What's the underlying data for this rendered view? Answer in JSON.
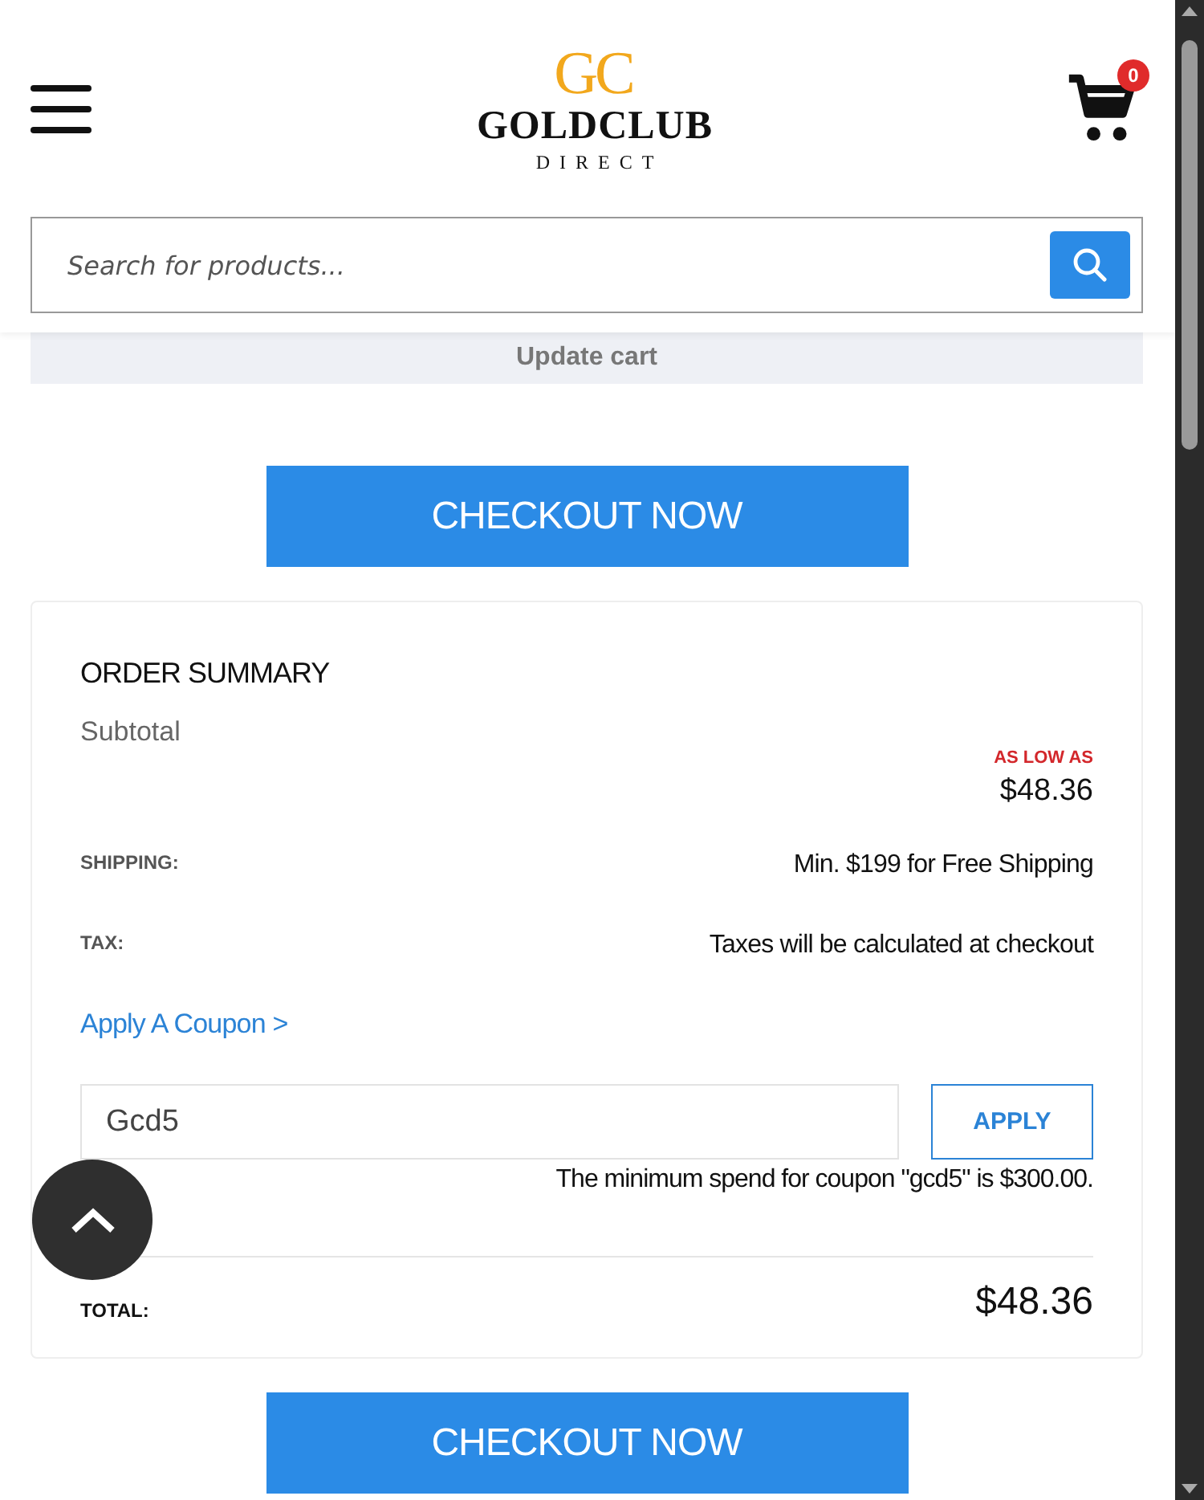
{
  "header": {
    "logo_mark": "GC",
    "logo_name": "GOLDCLUB",
    "logo_sub": "DIRECT",
    "cart_count": "0"
  },
  "search": {
    "placeholder": "Search for products..."
  },
  "update_cart": "Update cart",
  "checkout_top": "CHECKOUT NOW",
  "summary": {
    "title": "ORDER SUMMARY",
    "subtotal_label": "Subtotal",
    "price_note": "AS LOW AS",
    "subtotal": "$48.36",
    "rows": [
      {
        "label": "SHIPPING:",
        "value": "Min. $199 for Free Shipping"
      },
      {
        "label": "TAX:",
        "value": "Taxes will be calculated at checkout"
      }
    ],
    "coupon_link": "Apply A Coupon >",
    "coupon_value": "Gcd5",
    "apply": "APPLY",
    "coupon_error": "The minimum spend for coupon \"gcd5\" is $300.00.",
    "total_label": "TOTAL:",
    "total": "$48.36"
  },
  "checkout_bottom": "CHECKOUT NOW"
}
